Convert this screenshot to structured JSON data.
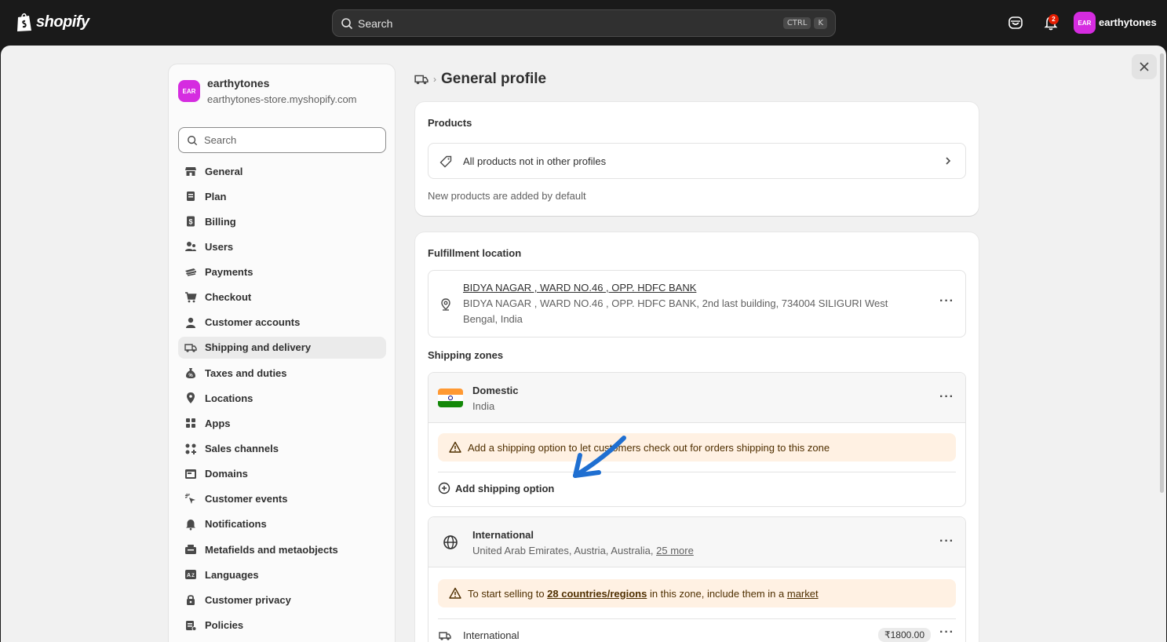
{
  "topbar": {
    "logo_text": "shopify",
    "search_placeholder": "Search",
    "shortcut_ctrl": "CTRL",
    "shortcut_k": "K",
    "notification_count": "2",
    "avatar_initials": "EAR",
    "store_name": "earthytones"
  },
  "sidebar": {
    "store_initials": "EAR",
    "store_name": "earthytones",
    "store_domain": "earthytones-store.myshopify.com",
    "search_placeholder": "Search",
    "items": [
      {
        "label": "General",
        "icon": "store-icon"
      },
      {
        "label": "Plan",
        "icon": "plan-icon"
      },
      {
        "label": "Billing",
        "icon": "billing-icon"
      },
      {
        "label": "Users",
        "icon": "users-icon"
      },
      {
        "label": "Payments",
        "icon": "payments-icon"
      },
      {
        "label": "Checkout",
        "icon": "cart-icon"
      },
      {
        "label": "Customer accounts",
        "icon": "person-icon"
      },
      {
        "label": "Shipping and delivery",
        "icon": "truck-icon"
      },
      {
        "label": "Taxes and duties",
        "icon": "tax-icon"
      },
      {
        "label": "Locations",
        "icon": "location-icon"
      },
      {
        "label": "Apps",
        "icon": "apps-icon"
      },
      {
        "label": "Sales channels",
        "icon": "channels-icon"
      },
      {
        "label": "Domains",
        "icon": "domains-icon"
      },
      {
        "label": "Customer events",
        "icon": "events-icon"
      },
      {
        "label": "Notifications",
        "icon": "bell-icon"
      },
      {
        "label": "Metafields and metaobjects",
        "icon": "metafields-icon"
      },
      {
        "label": "Languages",
        "icon": "languages-icon"
      },
      {
        "label": "Customer privacy",
        "icon": "lock-icon"
      },
      {
        "label": "Policies",
        "icon": "policies-icon"
      }
    ]
  },
  "main": {
    "page_title": "General profile",
    "products": {
      "title": "Products",
      "row_label": "All products not in other profiles",
      "note": "New products are added by default"
    },
    "fulfillment": {
      "title": "Fulfillment location",
      "location_name": "BIDYA NAGAR , WARD NO.46 , OPP. HDFC BANK",
      "address_line1": "BIDYA NAGAR , WARD NO.46 , OPP. HDFC BANK, 2nd last building, 734004 SILIGURI West",
      "address_line2": "Bengal, India"
    },
    "zones": {
      "title": "Shipping zones",
      "domestic": {
        "name": "Domestic",
        "region": "India",
        "warning": "Add a shipping option to let customers check out for orders shipping to this zone",
        "add_option": "Add shipping option"
      },
      "international": {
        "name": "International",
        "regions": "United Arab Emirates, Austria, Australia,",
        "more": "25 more",
        "warning_pre": "To start selling to",
        "warning_bold": "28 countries/regions",
        "warning_mid": "in this zone, include them in a",
        "warning_link": "market",
        "rate_name": "International",
        "rate_price": "₹1800.00"
      }
    }
  },
  "colors": {
    "brand_avatar": "#d52ce0",
    "warning_bg": "#fff1e3",
    "annotation_arrow": "#1f6fd1"
  }
}
